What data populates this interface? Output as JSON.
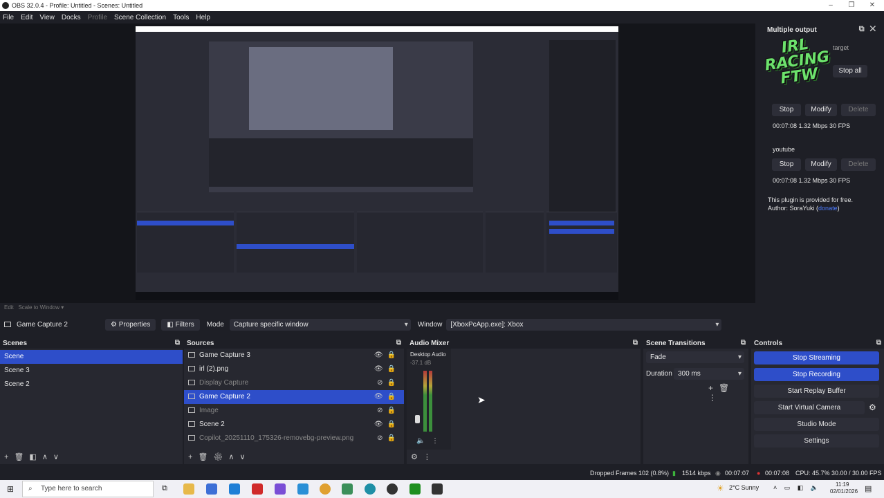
{
  "window": {
    "title": "OBS 32.0.4 - Profile: Untitled - Scenes: Untitled"
  },
  "menu": [
    {
      "label": "File",
      "disabled": false
    },
    {
      "label": "Edit",
      "disabled": false
    },
    {
      "label": "View",
      "disabled": false
    },
    {
      "label": "Docks",
      "disabled": false
    },
    {
      "label": "Profile",
      "disabled": true
    },
    {
      "label": "Scene Collection",
      "disabled": false
    },
    {
      "label": "Tools",
      "disabled": false
    },
    {
      "label": "Help",
      "disabled": false
    }
  ],
  "multiple_output": {
    "title": "Multiple output",
    "partial_text_1": "target",
    "stop_all": "Stop all",
    "targets": [
      {
        "name": "",
        "stop": "Stop",
        "modify": "Modify",
        "delete": "Delete",
        "stats": "00:07:08  1.32 Mbps  30 FPS"
      },
      {
        "name": "youtube",
        "stop": "Stop",
        "modify": "Modify",
        "delete": "Delete",
        "stats": "00:07:08  1.32 Mbps  30 FPS"
      }
    ],
    "plugin_note": "This plugin is provided for free.",
    "author_prefix": "Author: SoraYuki (",
    "author_link": "donate",
    "author_suffix": ")",
    "logo_text": [
      "IRL",
      "RACING",
      "FTW"
    ]
  },
  "hint": {
    "edit": "Edit",
    "scale": "Scale to Window"
  },
  "context": {
    "source": "Game Capture 2",
    "properties": "Properties",
    "filters": "Filters",
    "mode_label": "Mode",
    "mode_value": "Capture specific window",
    "window_label": "Window",
    "window_value": "[XboxPcApp.exe]: Xbox"
  },
  "scenes": {
    "title": "Scenes",
    "items": [
      {
        "name": "Scene",
        "selected": true
      },
      {
        "name": "Scene 3",
        "selected": false
      },
      {
        "name": "Scene 2",
        "selected": false
      }
    ]
  },
  "sources": {
    "title": "Sources",
    "items": [
      {
        "name": "Game Capture 3",
        "visible": true,
        "selected": false,
        "dim": false
      },
      {
        "name": "irl (2).png",
        "visible": true,
        "selected": false,
        "dim": false
      },
      {
        "name": "Display Capture",
        "visible": false,
        "selected": false,
        "dim": true
      },
      {
        "name": "Game Capture 2",
        "visible": true,
        "selected": true,
        "dim": false
      },
      {
        "name": "Image",
        "visible": false,
        "selected": false,
        "dim": true
      },
      {
        "name": "Scene 2",
        "visible": true,
        "selected": false,
        "dim": false
      },
      {
        "name": "Copilot_20251110_175326-removebg-preview.png",
        "visible": false,
        "selected": false,
        "dim": true
      }
    ]
  },
  "audio_mixer": {
    "title": "Audio Mixer",
    "channel": "Desktop Audio",
    "level": "-37.1 dB"
  },
  "transitions": {
    "title": "Scene Transitions",
    "type": "Fade",
    "duration_label": "Duration",
    "duration_value": "300 ms"
  },
  "controls": {
    "title": "Controls",
    "buttons": [
      {
        "label": "Stop Streaming",
        "active": true
      },
      {
        "label": "Stop Recording",
        "active": true
      },
      {
        "label": "Start Replay Buffer",
        "active": false
      },
      {
        "label": "Start Virtual Camera",
        "active": false
      },
      {
        "label": "Studio Mode",
        "active": false
      },
      {
        "label": "Settings",
        "active": false
      }
    ]
  },
  "status": {
    "dropped": "Dropped Frames 102 (0.8%)",
    "bitrate": "1514 kbps",
    "stream_time": "00:07:07",
    "rec_time": "00:07:08",
    "cpu": "CPU: 45.7%",
    "fps": "30.00 / 30.00 FPS"
  },
  "taskbar": {
    "search_placeholder": "Type here to search",
    "weather": "2°C  Sunny",
    "time": "11:19",
    "date": "02/01/2026"
  }
}
